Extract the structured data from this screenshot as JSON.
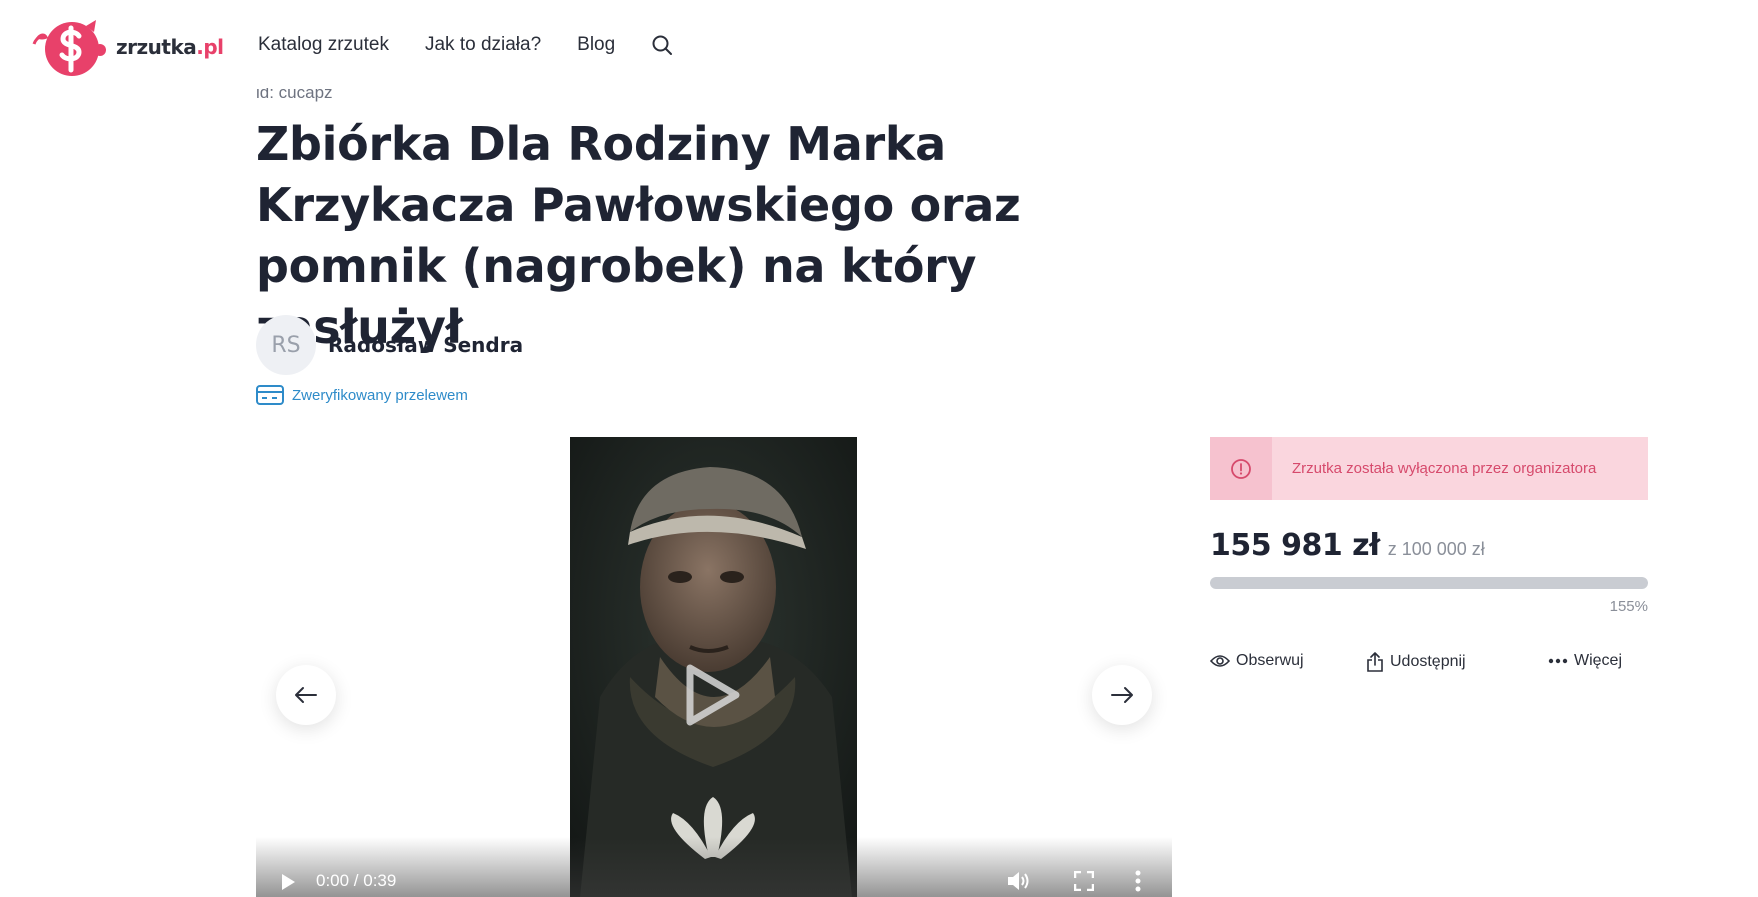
{
  "header": {
    "logo_text": "zrzutka",
    "logo_tld": ".pl",
    "nav": [
      "Katalog zrzutek",
      "Jak to działa?",
      "Blog"
    ],
    "search_icon": "search-icon"
  },
  "fundraiser": {
    "id_label": "id: cucapz",
    "title": "Zbiórka Dla Rodziny Marka Krzykacza Pawłowskiego oraz pomnik (nagrobek) na który zasłużył",
    "organizer_initials": "RS",
    "organizer_name": "Radosław Sendra",
    "verified_label": "Zweryfikowany przelewem"
  },
  "video": {
    "time": "0:00 / 0:39"
  },
  "panel": {
    "alert_text": "Zrzutka została wyłączona przez organizatora",
    "amount": "155 981 zł",
    "goal": "z 100 000 zł",
    "percent_label": "155%",
    "progress_fraction": 1.0,
    "actions": {
      "follow": "Obserwuj",
      "share": "Udostępnij",
      "more": "Więcej"
    }
  },
  "colors": {
    "brand": "#e8416a",
    "alert_bg": "#fad6de",
    "alert_text": "#d64a6c",
    "link": "#2e8bc9"
  }
}
